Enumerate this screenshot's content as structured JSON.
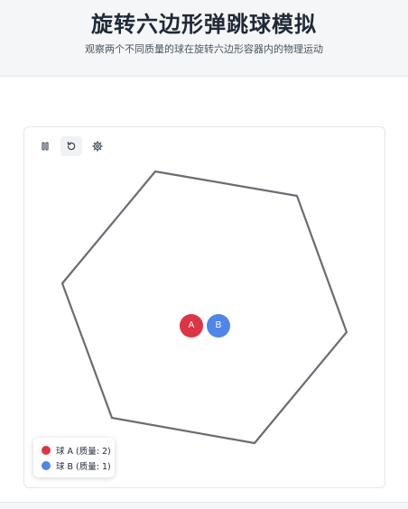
{
  "header": {
    "title": "旋转六边形弹跳球模拟",
    "subtitle": "观察两个不同质量的球在旋转六边形容器内的物理运动"
  },
  "toolbar": {
    "buttons": [
      {
        "name": "pause",
        "icon": "pause-icon"
      },
      {
        "name": "reset",
        "icon": "rotate-ccw-icon"
      },
      {
        "name": "settings",
        "icon": "gear-icon"
      }
    ]
  },
  "balls": [
    {
      "label": "A",
      "color": "#dc3545"
    },
    {
      "label": "B",
      "color": "#4f86e8"
    }
  ],
  "legend": {
    "items": [
      {
        "text": "球 A (质量: 2)",
        "color": "#dc3545"
      },
      {
        "text": "球 B (质量: 1)",
        "color": "#4f86e8"
      }
    ]
  },
  "colors": {
    "hexagon_stroke": "#6b6b73",
    "header_bg": "#f5f6f7"
  }
}
